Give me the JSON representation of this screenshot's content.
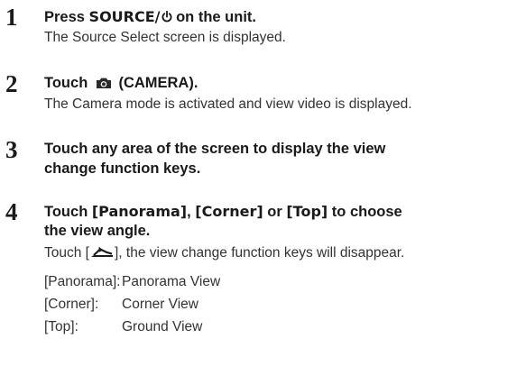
{
  "steps": [
    {
      "number": "1",
      "heading_prefix": "Press ",
      "heading_keyword": "SOURCE/",
      "heading_icon": "power-icon",
      "heading_suffix": " on the unit.",
      "description": "The Source Select screen is displayed."
    },
    {
      "number": "2",
      "heading_prefix": "Touch ",
      "heading_icon": "camera-icon",
      "heading_suffix": " (CAMERA).",
      "description": "The Camera mode is activated and view video is displayed."
    },
    {
      "number": "3",
      "heading_line1": "Touch any area of the screen to display the view",
      "heading_line2": "change function keys."
    },
    {
      "number": "4",
      "heading_prefix": "Touch ",
      "heading_kw1": "[Panorama]",
      "heading_sep1": ", ",
      "heading_kw2": "[Corner]",
      "heading_sep2": " or ",
      "heading_kw3": "[Top]",
      "heading_suffix": " to choose",
      "heading_line2": "the view angle.",
      "description_prefix": "Touch [",
      "description_icon": "return-icon",
      "description_suffix": "], the view change function keys will disappear.",
      "views": [
        {
          "key": "[Panorama]:",
          "value": "Panorama View"
        },
        {
          "key": "[Corner]:",
          "value": "Corner View"
        },
        {
          "key": "[Top]:",
          "value": "Ground View"
        }
      ]
    }
  ],
  "colors": {
    "text": "#1a1a1a",
    "body_text": "#333333",
    "background": "#ffffff"
  }
}
